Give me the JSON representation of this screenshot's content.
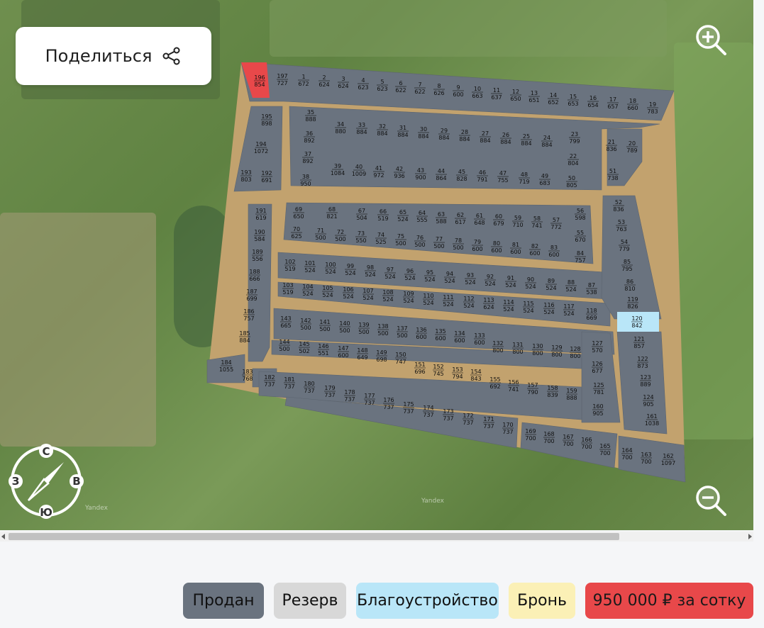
{
  "share": {
    "label": "Поделиться",
    "icon": "share-icon"
  },
  "map": {
    "watermark": "Yandex",
    "compass": {
      "n": "С",
      "s": "Ю",
      "w": "З",
      "e": "В"
    },
    "plot_colors": {
      "sold": "#6a737f",
      "road": "#c2a26e",
      "highlight_red": "#e8484a",
      "highlight_blue": "#b9e6f8"
    },
    "plots": [
      {
        "n": "196",
        "a": "854",
        "s": "red"
      },
      {
        "n": "197",
        "a": "727"
      },
      {
        "n": "1",
        "a": "672"
      },
      {
        "n": "2",
        "a": "624"
      },
      {
        "n": "3",
        "a": "624"
      },
      {
        "n": "4",
        "a": "623"
      },
      {
        "n": "5",
        "a": "623"
      },
      {
        "n": "6",
        "a": "622"
      },
      {
        "n": "7",
        "a": "622"
      },
      {
        "n": "8",
        "a": "626"
      },
      {
        "n": "9",
        "a": "600"
      },
      {
        "n": "10",
        "a": "663"
      },
      {
        "n": "11",
        "a": "637"
      },
      {
        "n": "12",
        "a": "650"
      },
      {
        "n": "13",
        "a": "651"
      },
      {
        "n": "14",
        "a": "652"
      },
      {
        "n": "15",
        "a": "653"
      },
      {
        "n": "16",
        "a": "654"
      },
      {
        "n": "17",
        "a": "657"
      },
      {
        "n": "18",
        "a": "660"
      },
      {
        "n": "19",
        "a": "783"
      },
      {
        "n": "195",
        "a": "898"
      },
      {
        "n": "35",
        "a": "888"
      },
      {
        "n": "34",
        "a": "880"
      },
      {
        "n": "33",
        "a": "884"
      },
      {
        "n": "32",
        "a": "884"
      },
      {
        "n": "31",
        "a": "884"
      },
      {
        "n": "30",
        "a": "884"
      },
      {
        "n": "29",
        "a": "884"
      },
      {
        "n": "28",
        "a": "884"
      },
      {
        "n": "27",
        "a": "884"
      },
      {
        "n": "26",
        "a": "884"
      },
      {
        "n": "25",
        "a": "884"
      },
      {
        "n": "24",
        "a": "884"
      },
      {
        "n": "23",
        "a": "799"
      },
      {
        "n": "21",
        "a": "836"
      },
      {
        "n": "20",
        "a": "789"
      },
      {
        "n": "194",
        "a": "1072"
      },
      {
        "n": "36",
        "a": "892"
      },
      {
        "n": "22",
        "a": "804"
      },
      {
        "n": "37",
        "a": "892"
      },
      {
        "n": "39",
        "a": "1084"
      },
      {
        "n": "40",
        "a": "1009"
      },
      {
        "n": "41",
        "a": "972"
      },
      {
        "n": "42",
        "a": "936"
      },
      {
        "n": "43",
        "a": "900"
      },
      {
        "n": "44",
        "a": "864"
      },
      {
        "n": "45",
        "a": "828"
      },
      {
        "n": "46",
        "a": "791"
      },
      {
        "n": "47",
        "a": "755"
      },
      {
        "n": "48",
        "a": "719"
      },
      {
        "n": "49",
        "a": "683"
      },
      {
        "n": "50",
        "a": "805"
      },
      {
        "n": "51",
        "a": "738"
      },
      {
        "n": "193",
        "a": "803"
      },
      {
        "n": "192",
        "a": "691"
      },
      {
        "n": "38",
        "a": "950"
      },
      {
        "n": "191",
        "a": "619"
      },
      {
        "n": "69",
        "a": "650"
      },
      {
        "n": "68",
        "a": "821"
      },
      {
        "n": "67",
        "a": "504"
      },
      {
        "n": "66",
        "a": "519"
      },
      {
        "n": "65",
        "a": "524"
      },
      {
        "n": "64",
        "a": "555"
      },
      {
        "n": "63",
        "a": "588"
      },
      {
        "n": "62",
        "a": "617"
      },
      {
        "n": "61",
        "a": "648"
      },
      {
        "n": "60",
        "a": "679"
      },
      {
        "n": "59",
        "a": "710"
      },
      {
        "n": "58",
        "a": "741"
      },
      {
        "n": "57",
        "a": "772"
      },
      {
        "n": "56",
        "a": "598"
      },
      {
        "n": "52",
        "a": "836"
      },
      {
        "n": "190",
        "a": "584"
      },
      {
        "n": "70",
        "a": "625"
      },
      {
        "n": "71",
        "a": "500"
      },
      {
        "n": "72",
        "a": "500"
      },
      {
        "n": "73",
        "a": "550"
      },
      {
        "n": "74",
        "a": "525"
      },
      {
        "n": "75",
        "a": "500"
      },
      {
        "n": "76",
        "a": "500"
      },
      {
        "n": "77",
        "a": "500"
      },
      {
        "n": "78",
        "a": "500"
      },
      {
        "n": "79",
        "a": "600"
      },
      {
        "n": "80",
        "a": "600"
      },
      {
        "n": "81",
        "a": "600"
      },
      {
        "n": "82",
        "a": "600"
      },
      {
        "n": "83",
        "a": "600"
      },
      {
        "n": "55",
        "a": "670"
      },
      {
        "n": "53",
        "a": "763"
      },
      {
        "n": "54",
        "a": "779"
      },
      {
        "n": "189",
        "a": "556"
      },
      {
        "n": "84",
        "a": "757"
      },
      {
        "n": "188",
        "a": "666"
      },
      {
        "n": "102",
        "a": "519"
      },
      {
        "n": "101",
        "a": "524"
      },
      {
        "n": "100",
        "a": "524"
      },
      {
        "n": "99",
        "a": "524"
      },
      {
        "n": "98",
        "a": "524"
      },
      {
        "n": "97",
        "a": "524"
      },
      {
        "n": "96",
        "a": "524"
      },
      {
        "n": "95",
        "a": "524"
      },
      {
        "n": "94",
        "a": "524"
      },
      {
        "n": "93",
        "a": "524"
      },
      {
        "n": "92",
        "a": "524"
      },
      {
        "n": "91",
        "a": "524"
      },
      {
        "n": "90",
        "a": "524"
      },
      {
        "n": "89",
        "a": "524"
      },
      {
        "n": "88",
        "a": "524"
      },
      {
        "n": "87",
        "a": "538"
      },
      {
        "n": "85",
        "a": "795"
      },
      {
        "n": "86",
        "a": "810"
      },
      {
        "n": "187",
        "a": "699"
      },
      {
        "n": "103",
        "a": "519"
      },
      {
        "n": "104",
        "a": "524"
      },
      {
        "n": "105",
        "a": "524"
      },
      {
        "n": "106",
        "a": "524"
      },
      {
        "n": "107",
        "a": "524"
      },
      {
        "n": "108",
        "a": "524"
      },
      {
        "n": "109",
        "a": "524"
      },
      {
        "n": "110",
        "a": "524"
      },
      {
        "n": "111",
        "a": "524"
      },
      {
        "n": "112",
        "a": "524"
      },
      {
        "n": "113",
        "a": "624"
      },
      {
        "n": "114",
        "a": "524"
      },
      {
        "n": "115",
        "a": "524"
      },
      {
        "n": "116",
        "a": "524"
      },
      {
        "n": "117",
        "a": "524"
      },
      {
        "n": "118",
        "a": "669"
      },
      {
        "n": "119",
        "a": "826"
      },
      {
        "n": "186",
        "a": "757"
      },
      {
        "n": "143",
        "a": "665"
      },
      {
        "n": "142",
        "a": "500"
      },
      {
        "n": "141",
        "a": "500"
      },
      {
        "n": "140",
        "a": "500"
      },
      {
        "n": "139",
        "a": "500"
      },
      {
        "n": "138",
        "a": "500"
      },
      {
        "n": "137",
        "a": "500"
      },
      {
        "n": "136",
        "a": "600"
      },
      {
        "n": "135",
        "a": "600"
      },
      {
        "n": "134",
        "a": "600"
      },
      {
        "n": "133",
        "a": "600"
      },
      {
        "n": "120",
        "a": "842",
        "s": "blue"
      },
      {
        "n": "185",
        "a": "884"
      },
      {
        "n": "144",
        "a": "500"
      },
      {
        "n": "145",
        "a": "502"
      },
      {
        "n": "146",
        "a": "551"
      },
      {
        "n": "147",
        "a": "600"
      },
      {
        "n": "148",
        "a": "649"
      },
      {
        "n": "149",
        "a": "698"
      },
      {
        "n": "150",
        "a": "747"
      },
      {
        "n": "132",
        "a": "800"
      },
      {
        "n": "131",
        "a": "800"
      },
      {
        "n": "130",
        "a": "800"
      },
      {
        "n": "129",
        "a": "800"
      },
      {
        "n": "128",
        "a": "800"
      },
      {
        "n": "127",
        "a": "570"
      },
      {
        "n": "121",
        "a": "857"
      },
      {
        "n": "184",
        "a": "1055"
      },
      {
        "n": "183",
        "a": "768"
      },
      {
        "n": "151",
        "a": "696"
      },
      {
        "n": "152",
        "a": "745"
      },
      {
        "n": "153",
        "a": "794"
      },
      {
        "n": "154",
        "a": "843"
      },
      {
        "n": "126",
        "a": "677"
      },
      {
        "n": "122",
        "a": "873"
      },
      {
        "n": "182",
        "a": "737"
      },
      {
        "n": "181",
        "a": "737"
      },
      {
        "n": "180",
        "a": "737"
      },
      {
        "n": "179",
        "a": "737"
      },
      {
        "n": "178",
        "a": "737"
      },
      {
        "n": "177",
        "a": "737"
      },
      {
        "n": "176",
        "a": "737"
      },
      {
        "n": "175",
        "a": "737"
      },
      {
        "n": "174",
        "a": "737"
      },
      {
        "n": "173",
        "a": "737"
      },
      {
        "n": "172",
        "a": "737"
      },
      {
        "n": "171",
        "a": "737"
      },
      {
        "n": "170",
        "a": "737"
      },
      {
        "n": "155",
        "a": "692"
      },
      {
        "n": "156",
        "a": "741"
      },
      {
        "n": "157",
        "a": "790"
      },
      {
        "n": "158",
        "a": "839"
      },
      {
        "n": "159",
        "a": "888"
      },
      {
        "n": "125",
        "a": "781"
      },
      {
        "n": "123",
        "a": "889"
      },
      {
        "n": "160",
        "a": "905"
      },
      {
        "n": "124",
        "a": "905"
      },
      {
        "n": "169",
        "a": "700"
      },
      {
        "n": "168",
        "a": "700"
      },
      {
        "n": "167",
        "a": "700"
      },
      {
        "n": "166",
        "a": "700"
      },
      {
        "n": "165",
        "a": "700"
      },
      {
        "n": "161",
        "a": "1038"
      },
      {
        "n": "164",
        "a": "700"
      },
      {
        "n": "163",
        "a": "700"
      },
      {
        "n": "162",
        "a": "1097"
      }
    ]
  },
  "legend": {
    "sold": "Продан",
    "reserve": "Резерв",
    "improvement": "Благоустройство",
    "booking": "Бронь",
    "price": "950 000 ₽ за сотку"
  }
}
